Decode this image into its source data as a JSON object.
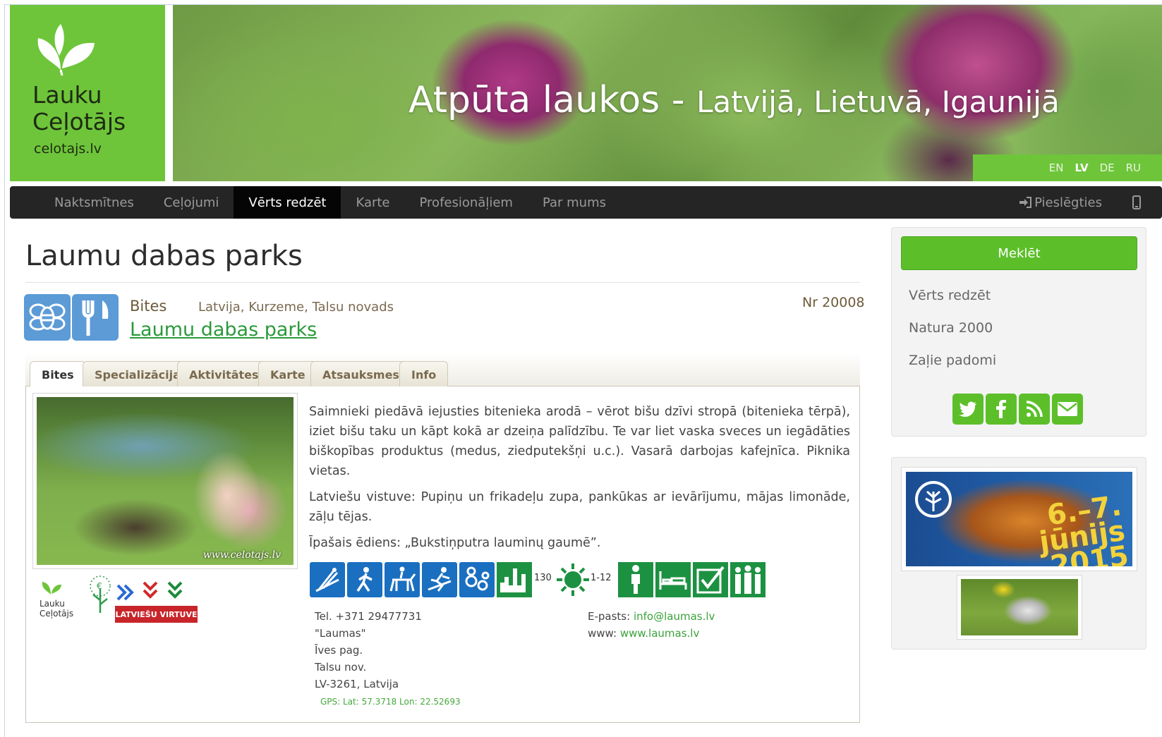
{
  "header": {
    "logo_line1": "Lauku",
    "logo_line2": "Ceļotājs",
    "logo_line3": "celotajs.lv",
    "banner_title_main": "Atpūta laukos - ",
    "banner_title_sub": "Latvijā, Lietuvā, Igaunijā",
    "languages": [
      "EN",
      "LV",
      "DE",
      "RU"
    ],
    "active_language": "LV"
  },
  "nav": {
    "items": [
      "Naktsmītnes",
      "Ceļojumi",
      "Vērts redzēt",
      "Karte",
      "Profesionāļiem",
      "Par mums"
    ],
    "active": "Vērts redzēt",
    "login": "Pieslēgties"
  },
  "main": {
    "title": "Laumu dabas parks",
    "category_label": "Bites",
    "location": "Latvija, Kurzeme, Talsu novads",
    "object_link": "Laumu dabas parks",
    "number": "Nr 20008",
    "category_icons": [
      "bee-icon",
      "fork-knife-icon"
    ],
    "tabs": [
      "Bites",
      "Specializācija",
      "Aktivitātes",
      "Karte",
      "Atsauksmes",
      "Info"
    ],
    "active_tab": "Bites",
    "photo_watermark": "www.celotajs.lv",
    "description": [
      "Saimnieki piedāvā iejusties bitenieka arodā – vērot bišu dzīvi stropā (bitenieka tērpā), iziet bišu taku un kāpt kokā ar dzeiņa palīdzību. Te var liet vaska sveces un iegādāties biškopības produktus (medus, ziedputekšņi u.c.). Vasarā darbojas kafejnīca. Piknika vietas.",
      "Latviešu vistuve: Pupiņu un frikadeļu zupa, pankūkas ar ievārījumu, mājas limonāde, zāļu tējas.",
      "Īpašais ēdiens: „Bukstiņputra lauminų gaumē”."
    ],
    "amenities": [
      {
        "icon": "ski-jump-icon"
      },
      {
        "icon": "hiking-icon"
      },
      {
        "icon": "horse-riding-icon"
      },
      {
        "icon": "skiing-icon"
      },
      {
        "icon": "children-icon"
      },
      {
        "icon": "capacity-icon",
        "green": true,
        "value": "130"
      },
      {
        "icon": "season-sun-icon",
        "green": true,
        "value": "1-12"
      },
      {
        "icon": "single-person-icon",
        "green": true
      },
      {
        "icon": "bed-icon",
        "green": true
      },
      {
        "icon": "checkmark-icon",
        "green": true
      },
      {
        "icon": "group-icon",
        "green": true
      }
    ],
    "contact_left": [
      "Tel. +371 29477731",
      "\"Laumas\"",
      "Īves pag.",
      "Talsu nov.",
      "LV-3261, Latvija"
    ],
    "email_label": "E-pasts:",
    "email_value": "info@laumas.lv",
    "www_label": "www:",
    "www_value": "www.laumas.lv",
    "gps": "GPS: Lat: 57.3718 Lon: 22.52693",
    "badge_lauku": "Lauku",
    "badge_celotajs": "Ceļotājs",
    "badge_latvian": "LATVIEŠU VIRTUVE"
  },
  "sidebar": {
    "search_button": "Meklēt",
    "links": [
      "Vērts redzēt",
      "Natura 2000",
      "Zaļie padomi"
    ],
    "social": [
      "twitter-icon",
      "facebook-icon",
      "rss-icon",
      "email-icon"
    ],
    "ad_text_line1": "6.–7.",
    "ad_text_line2": "jūnijs",
    "ad_text_line3": "2015"
  },
  "colors": {
    "brand_green": "#6ec53a",
    "nav_dark": "#252525",
    "amenity_blue": "#1a6fc0",
    "amenity_green": "#1d9142",
    "link_green": "#2a9a3a"
  }
}
